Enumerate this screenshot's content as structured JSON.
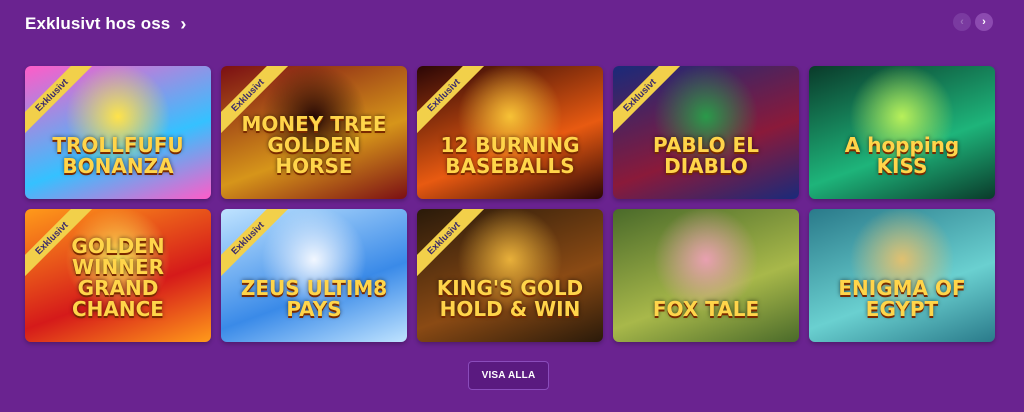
{
  "section": {
    "title": "Exklusivt hos oss",
    "title_chevron": "›",
    "nav_prev": "‹",
    "nav_next": "›"
  },
  "badge_label": "Exklusivt",
  "games": [
    {
      "name": "TROLLFUFU BONANZA",
      "exclusive": true,
      "colors": [
        "#ff5cc8",
        "#35c1ff",
        "#ffe34a"
      ]
    },
    {
      "name": "MONEY TREE GOLDEN HORSE",
      "exclusive": true,
      "colors": [
        "#7b0f14",
        "#d6951a",
        "#2a0a05"
      ]
    },
    {
      "name": "12 BURNING BASEBALLS",
      "exclusive": true,
      "colors": [
        "#2b0606",
        "#e85a11",
        "#f7c236"
      ]
    },
    {
      "name": "PABLO EL DIABLO",
      "exclusive": true,
      "colors": [
        "#1a2a7a",
        "#8a1a3a",
        "#2a9a4a"
      ]
    },
    {
      "name": "A hopping KISS",
      "exclusive": false,
      "colors": [
        "#0a3a2a",
        "#1eb47a",
        "#b8f05a"
      ]
    },
    {
      "name": "GOLDEN WINNER GRAND CHANCE",
      "exclusive": true,
      "colors": [
        "#ff9a1a",
        "#d51a1a",
        "#ffea5a"
      ]
    },
    {
      "name": "ZEUS ULTIM8 PAYS",
      "exclusive": true,
      "colors": [
        "#bfe3ff",
        "#3a8ae8",
        "#f2f7ff"
      ]
    },
    {
      "name": "KING'S GOLD HOLD & WIN",
      "exclusive": true,
      "colors": [
        "#2a1a0a",
        "#8a4a14",
        "#e8b03a"
      ]
    },
    {
      "name": "FOX TALE",
      "exclusive": false,
      "colors": [
        "#4a6a2a",
        "#a8b84a",
        "#e8a0b0"
      ]
    },
    {
      "name": "ENIGMA OF EGYPT",
      "exclusive": false,
      "colors": [
        "#2a7a8a",
        "#6ad0d0",
        "#e0c070"
      ]
    }
  ],
  "cta": {
    "label": "VISA ALLA"
  }
}
